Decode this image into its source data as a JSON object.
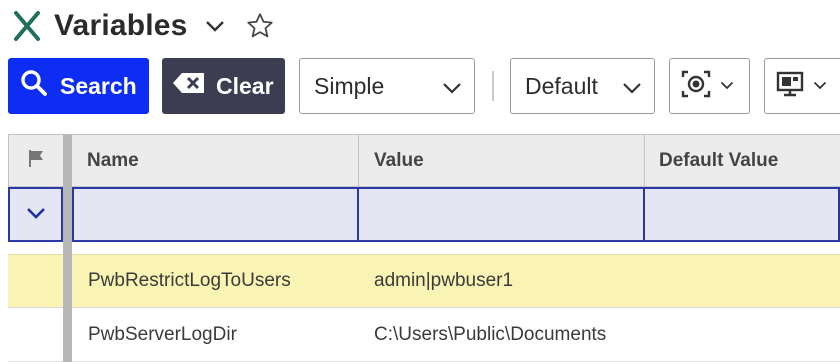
{
  "header": {
    "title": "Variables",
    "app_icon": "x-logo-icon",
    "chevron_icon": "chevron-down-icon",
    "favorite_icon": "star-outline-icon"
  },
  "toolbar": {
    "search_label": "Search",
    "clear_label": "Clear",
    "mode_select_value": "Simple",
    "view_select_value": "Default",
    "camera_icon": "screenshot-target-icon",
    "monitor_icon": "monitor-icon"
  },
  "grid": {
    "columns": [
      "Name",
      "Value",
      "Default Value"
    ],
    "rows": [
      {
        "name": "PwbRestrictLogToUsers",
        "value": "admin|pwbuser1",
        "default_value": "",
        "highlighted": true
      },
      {
        "name": "PwbServerLogDir",
        "value": "C:\\Users\\Public\\Documents",
        "default_value": "",
        "highlighted": false
      }
    ]
  },
  "colors": {
    "brand_green": "#1f6f5c",
    "search_blue": "#0d2ef2",
    "clear_dark": "#3d3d52",
    "filter_border": "#2a37a8",
    "filter_bg": "#e4e7f3",
    "highlight_row": "#faf4b4"
  }
}
